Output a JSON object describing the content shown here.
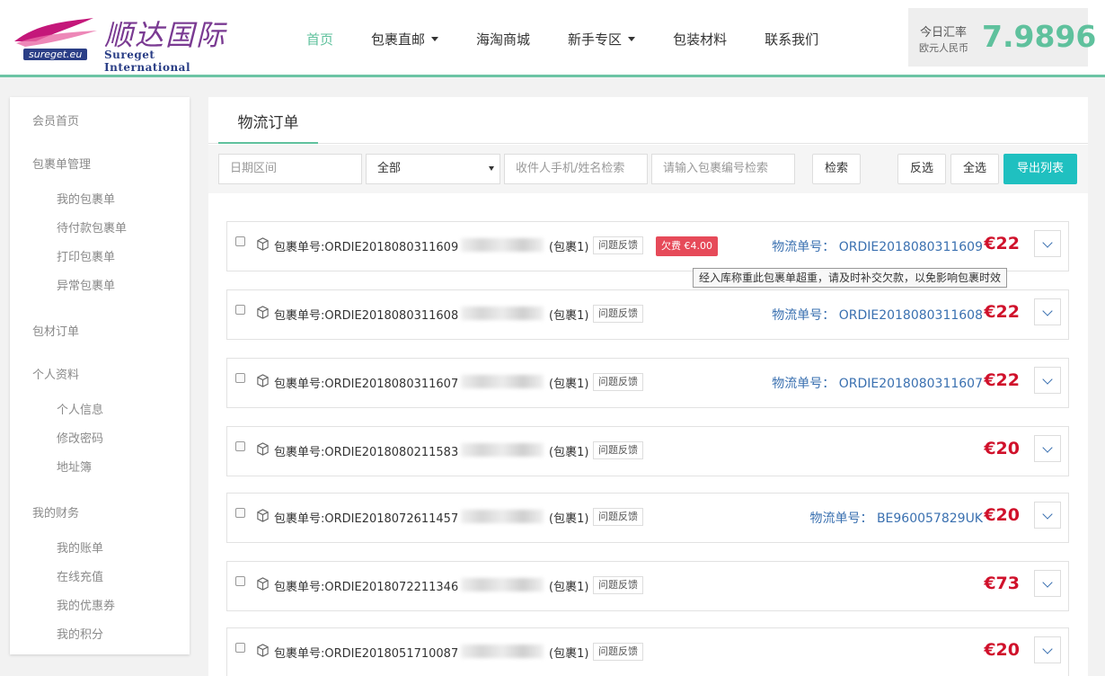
{
  "header": {
    "logo_cn": "顺达国际",
    "logo_en": "Sureget International",
    "logo_site": "sureget.eu",
    "nav": [
      {
        "label": "首页",
        "active": true
      },
      {
        "label": "包裹直邮",
        "dropdown": true
      },
      {
        "label": "海淘商城"
      },
      {
        "label": "新手专区",
        "dropdown": true
      },
      {
        "label": "包装材料"
      },
      {
        "label": "联系我们"
      }
    ],
    "rate": {
      "label": "今日汇率",
      "sub": "欧元人民币",
      "value": "7.9896"
    }
  },
  "sidebar": {
    "member_home": "会员首页",
    "parcel_mgmt": "包裹单管理",
    "parcel_items": [
      "我的包裹单",
      "待付款包裹单",
      "打印包裹单",
      "异常包裹单"
    ],
    "material_orders": "包材订单",
    "profile": "个人资料",
    "profile_items": [
      "个人信息",
      "修改密码",
      "地址簿"
    ],
    "finance": "我的财务",
    "finance_items": [
      "我的账单",
      "在线充值",
      "我的优惠券",
      "我的积分"
    ]
  },
  "main": {
    "tab": "物流订单",
    "filters": {
      "date_placeholder": "日期区间",
      "status_selected": "全部",
      "recipient_placeholder": "收件人手机/姓名检索",
      "parcel_placeholder": "请输入包裹编号检索",
      "search_btn": "检索",
      "invert_btn": "反选",
      "select_all_btn": "全选",
      "export_btn": "导出列表"
    },
    "tooltip": "经入库称重此包裹单超重，请及时补交欠款，以免影响包裹时效",
    "orders": [
      {
        "id": "包裹单号:ORDIE2018080311609",
        "suffix": "(包裹1)",
        "feedback": "问题反馈",
        "debt": "欠费 €4.00",
        "tracking": "物流单号： ORDIE2018080311609",
        "price": "€22"
      },
      {
        "id": "包裹单号:ORDIE2018080311608",
        "suffix": "(包裹1)",
        "feedback": "问题反馈",
        "debt": "",
        "tracking": "物流单号： ORDIE2018080311608",
        "price": "€22"
      },
      {
        "id": "包裹单号:ORDIE2018080311607",
        "suffix": "(包裹1)",
        "feedback": "问题反馈",
        "debt": "",
        "tracking": "物流单号： ORDIE2018080311607",
        "price": "€22"
      },
      {
        "id": "包裹单号:ORDIE2018080211583",
        "suffix": "(包裹1)",
        "feedback": "问题反馈",
        "debt": "",
        "tracking": "",
        "price": "€20"
      },
      {
        "id": "包裹单号:ORDIE2018072611457",
        "suffix": "(包裹1)",
        "feedback": "问题反馈",
        "debt": "",
        "tracking": "物流单号： BE960057829UK",
        "price": "€20"
      },
      {
        "id": "包裹单号:ORDIE2018072211346",
        "suffix": "(包裹1)",
        "feedback": "问题反馈",
        "debt": "",
        "tracking": "",
        "price": "€73"
      },
      {
        "id": "包裹单号:ORDIE2018051710087",
        "suffix": "(包裹1)",
        "feedback": "问题反馈",
        "debt": "",
        "tracking": "",
        "price": "€20"
      }
    ]
  },
  "colors": {
    "accent": "#5fc19d",
    "export": "#1fc0c0",
    "price": "#d0112b",
    "debt": "#e64a59",
    "link": "#3a70b0"
  }
}
